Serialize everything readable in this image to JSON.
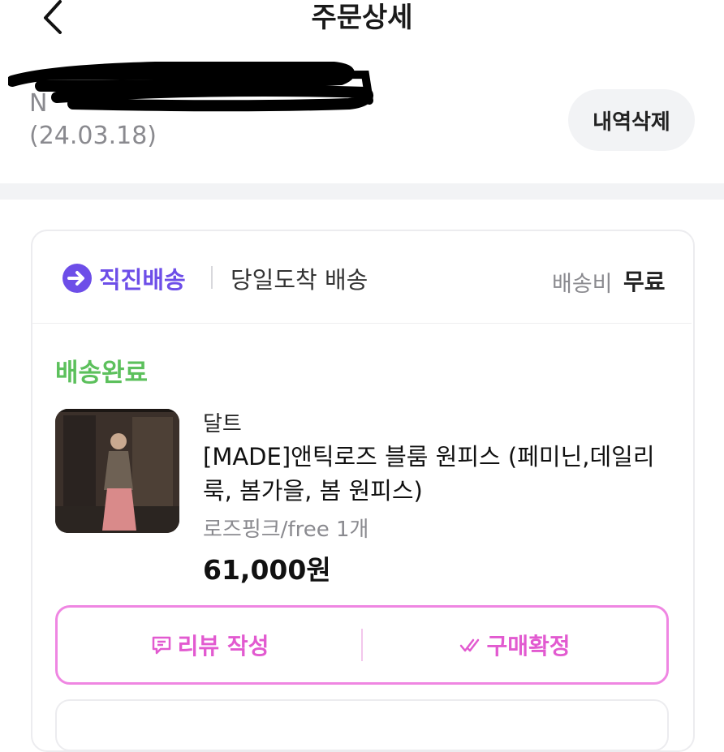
{
  "header": {
    "title": "주문상세",
    "back_icon": "chevron-left-icon"
  },
  "order": {
    "number_visible": "N",
    "date": "(24.03.18)",
    "delete_label": "내역삭제"
  },
  "shipping": {
    "brand": "직진배송",
    "type": "당일도착 배송",
    "fee_label": "배송비",
    "fee_value": "무료",
    "icon": "arrow-right-circle-icon"
  },
  "status": {
    "label": "배송완료"
  },
  "product": {
    "brand": "달트",
    "name": "[MADE]앤틱로즈 블룸 원피스 (페미닌,데일리룩, 봄가을, 봄 원피스)",
    "option": "로즈핑크/free 1개",
    "price": "61,000원"
  },
  "actions": {
    "review_label": "리뷰 작성",
    "confirm_label": "구매확정",
    "review_icon": "review-bubble-icon",
    "confirm_icon": "double-check-icon"
  },
  "colors": {
    "accent_purple": "#6d4ee8",
    "status_green": "#5cc05c",
    "action_pink": "#e25ad0",
    "gray_text": "#8a8a8f"
  }
}
